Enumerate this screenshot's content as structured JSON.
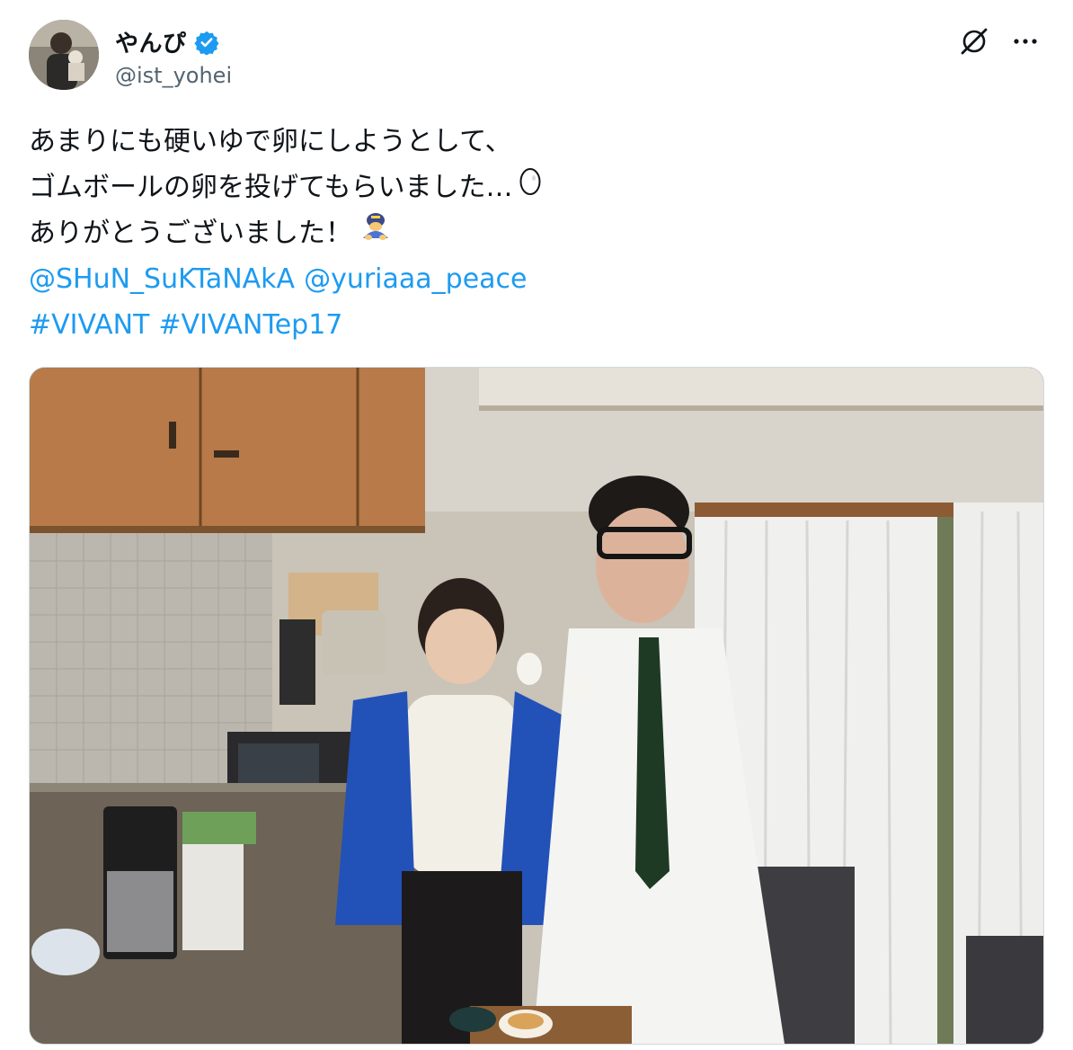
{
  "author": {
    "display_name": "やんぴ",
    "handle": "@ist_yohei",
    "verified": true,
    "verified_color": "#1d9bf0"
  },
  "actions": {
    "grok_icon": "grok-icon",
    "more_icon": "more-icon"
  },
  "tweet": {
    "line1": "あまりにも硬いゆで卵にしようとして、",
    "line2": "ゴムボールの卵を投げてもらいました…",
    "line2_emoji": "egg-emoji",
    "line3": "ありがとうございました！",
    "line3_emoji": "bowing-person-emoji",
    "mention1": "@SHuN_SuKTaNAkA",
    "mention2": "@yuriaaa_peace",
    "hashtag1": "#VIVANT",
    "hashtag2": "#VIVANTep17"
  },
  "media": {
    "type": "photo",
    "subject": "two people holding eggs in a kitchen"
  },
  "colors": {
    "text": "#0f1419",
    "secondary": "#536471",
    "link": "#1d9bf0",
    "border": "#cfd9de"
  }
}
